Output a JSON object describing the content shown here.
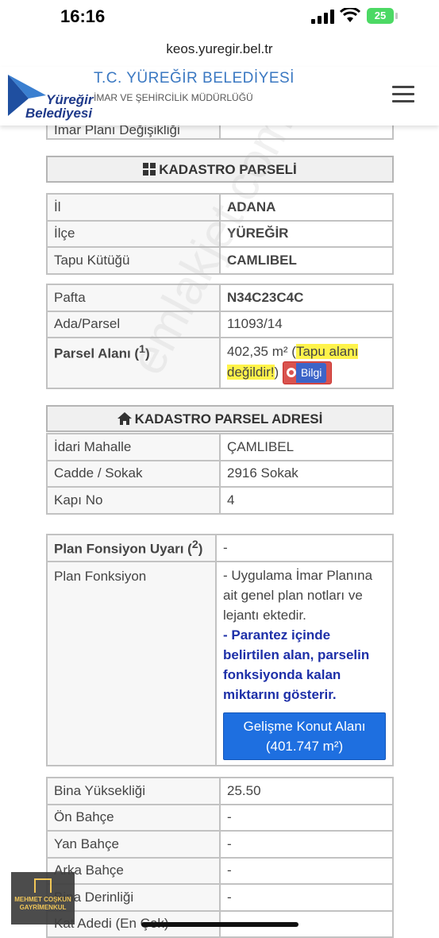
{
  "status": {
    "time": "16:16",
    "battery": "25"
  },
  "browser": {
    "url": "keos.yuregir.bel.tr"
  },
  "header": {
    "logo_line1": "Yüreğir",
    "logo_line2": "Belediyesi",
    "title": "T.C. YÜREĞİR BELEDİYESİ",
    "subtitle": "İMAR VE ŞEHİRCİLİK MÜDÜRLÜĞÜ"
  },
  "top_partial": {
    "label": "İmar Planı Değişikliği"
  },
  "kadastro": {
    "heading": "KADASTRO PARSELİ",
    "il_label": "İl",
    "il_value": "ADANA",
    "ilce_label": "İlçe",
    "ilce_value": "YÜREĞİR",
    "tapu_label": "Tapu Kütüğü",
    "tapu_value": "CAMLIBEL",
    "pafta_label": "Pafta",
    "pafta_value": "N34C23C4C",
    "ada_label": "Ada/Parsel",
    "ada_value": "11093/14",
    "alan_label": "Parsel Alanı (",
    "alan_sup": "1",
    "alan_close": ")",
    "alan_value": "402,35 m²",
    "alan_note_open": " (",
    "alan_note": "Tapu alanı değildir!",
    "alan_note_close": ")",
    "bilgi_label": "Bilgi"
  },
  "adres": {
    "heading": "KADASTRO PARSEL ADRESİ",
    "mahalle_label": "İdari Mahalle",
    "mahalle_value": "ÇAMLIBEL",
    "cadde_label": "Cadde / Sokak",
    "cadde_value": "2916 Sokak",
    "kapi_label": "Kapı No",
    "kapi_value": "4"
  },
  "plan": {
    "uyari_label": "Plan Fonsiyon Uyarı (",
    "uyari_sup": "2",
    "uyari_close": ")",
    "uyari_value": "-",
    "fonksiyon_label": "Plan Fonksiyon",
    "text1": "- Uygulama İmar Planına ait genel plan notları ve lejantı ektedir.",
    "note": "- Parantez içinde belirtilen alan, parselin fonksiyonda kalan miktarını gösterir.",
    "button_line1": "Gelişme Konut Alanı",
    "button_line2": "(401.747 m²)"
  },
  "bina": {
    "yukseklik_label": "Bina Yüksekliği",
    "yukseklik_value": "25.50",
    "on_label": "Ön Bahçe",
    "on_value": "-",
    "yan_label": "Yan Bahçe",
    "yan_value": "-",
    "arka_label": "Arka Bahçe",
    "arka_value": "-",
    "derinlik_label": "Bina Derinliği",
    "derinlik_value": "-",
    "kat_label": "Kat Adedi (En Çok)"
  },
  "watermark": "emlakjet.com",
  "corner_logo": {
    "line1": "MEHMET COŞKUN",
    "line2": "GAYRİMENKUL"
  }
}
